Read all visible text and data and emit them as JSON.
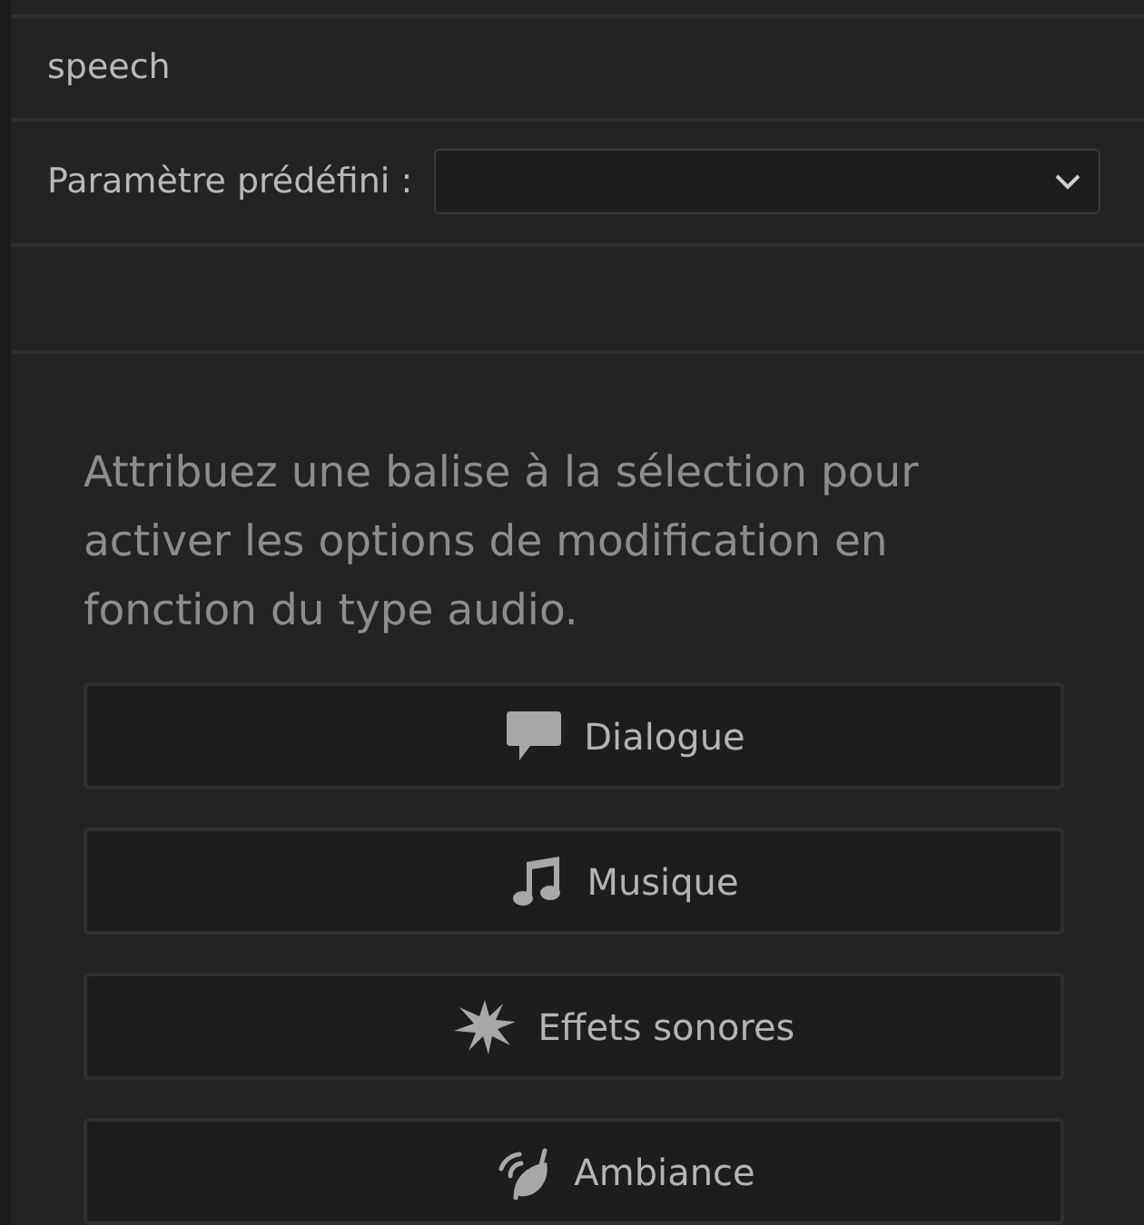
{
  "clip_name": "speech",
  "preset": {
    "label": "Paramètre prédéfini :"
  },
  "message": "Attribuez une balise à la sélection pour activer les options de modification en fonction du type audio.",
  "audio_types": [
    {
      "kind": "dialogue",
      "label": "Dialogue"
    },
    {
      "kind": "music",
      "label": "Musique"
    },
    {
      "kind": "sfx",
      "label": "Effets sonores"
    },
    {
      "kind": "ambiance",
      "label": "Ambiance"
    }
  ]
}
